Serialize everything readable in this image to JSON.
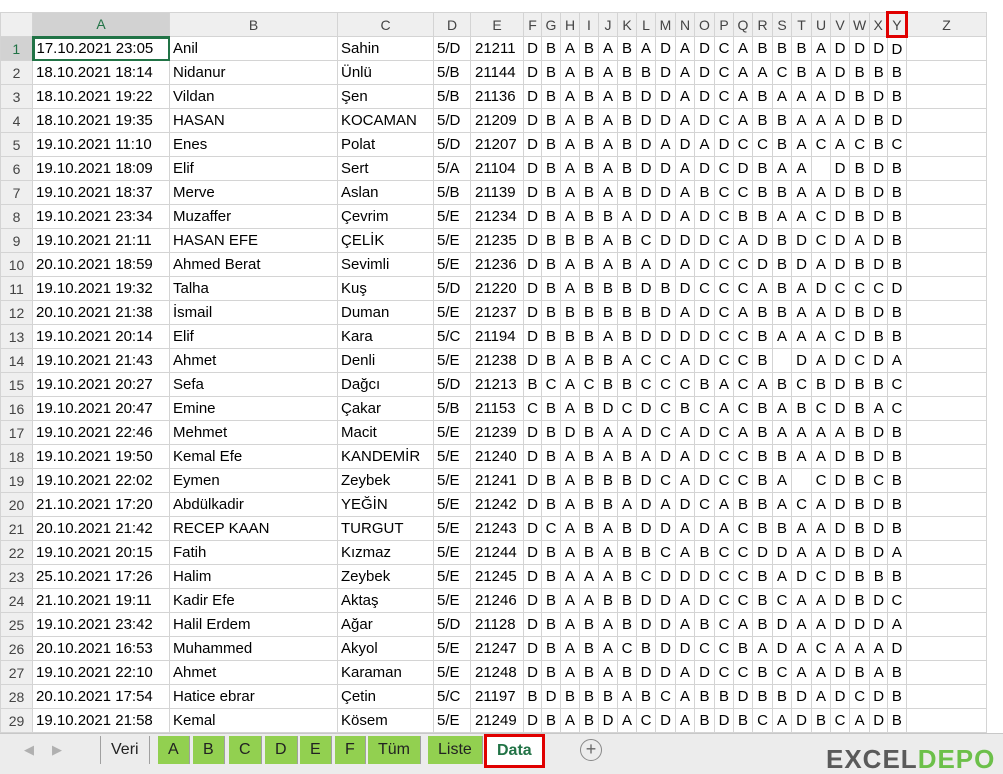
{
  "columns": [
    "A",
    "B",
    "C",
    "D",
    "E",
    "F",
    "G",
    "H",
    "I",
    "J",
    "K",
    "L",
    "M",
    "N",
    "O",
    "P",
    "Q",
    "R",
    "S",
    "T",
    "U",
    "V",
    "W",
    "X",
    "Y",
    "Z"
  ],
  "selected_column": "Y",
  "rows": [
    {
      "n": "1",
      "a": "17.10.2021 23:05",
      "b": "Anil",
      "c": "Sahin",
      "d": "5/D",
      "e": "21211",
      "ans": "DBABABADADCABBBADDDD"
    },
    {
      "n": "2",
      "a": "18.10.2021 18:14",
      "b": "Nidanur",
      "c": "Ünlü",
      "d": "5/B",
      "e": "21144",
      "ans": "DBABABBDADCAACBADBBB"
    },
    {
      "n": "3",
      "a": "18.10.2021 19:22",
      "b": "Vildan",
      "c": "Şen",
      "d": "5/B",
      "e": "21136",
      "ans": "DBABABDDADCABAAADBDB"
    },
    {
      "n": "4",
      "a": "18.10.2021 19:35",
      "b": "HASAN",
      "c": "KOCAMAN",
      "d": "5/D",
      "e": "21209",
      "ans": "DBABABDDADCABBAAADBDB"
    },
    {
      "n": "5",
      "a": "19.10.2021 11:10",
      "b": "Enes",
      "c": "Polat",
      "d": "5/D",
      "e": "21207",
      "ans": "DBABABDADADCCBACACBCB"
    },
    {
      "n": "6",
      "a": "19.10.2021 18:09",
      "b": "Elif",
      "c": "Sert",
      "d": "5/A",
      "e": "21104",
      "ans": "DBABABDDADCDBAA DBDB"
    },
    {
      "n": "7",
      "a": "19.10.2021 18:37",
      "b": "Merve",
      "c": "Aslan",
      "d": "5/B",
      "e": "21139",
      "ans": "DBABABDDABCCBBAADBDB"
    },
    {
      "n": "8",
      "a": "19.10.2021 23:34",
      "b": "Muzaffer",
      "c": "Çevrim",
      "d": "5/E",
      "e": "21234",
      "ans": "DBABBADDADCBBAACDBDB"
    },
    {
      "n": "9",
      "a": "19.10.2021 21:11",
      "b": "HASAN EFE",
      "c": "ÇELİK",
      "d": "5/E",
      "e": "21235",
      "ans": "DBBBABCDDDCADBDCDADB"
    },
    {
      "n": "10",
      "a": "20.10.2021 18:59",
      "b": "Ahmed Berat",
      "c": "Sevimli",
      "d": "5/E",
      "e": "21236",
      "ans": "DBABABADADCCDBDADBDB"
    },
    {
      "n": "11",
      "a": "19.10.2021 19:32",
      "b": "Talha",
      "c": "Kuş",
      "d": "5/D",
      "e": "21220",
      "ans": "DBABBBDBDCCCABADCCCD"
    },
    {
      "n": "12",
      "a": "20.10.2021 21:38",
      "b": "İsmail",
      "c": "Duman",
      "d": "5/E",
      "e": "21237",
      "ans": "DBBBBBBDADCABBAADBDB"
    },
    {
      "n": "13",
      "a": "19.10.2021 20:14",
      "b": "Elif",
      "c": "Kara",
      "d": "5/C",
      "e": "21194",
      "ans": "DBBBABDDDDCCBAAACDBB"
    },
    {
      "n": "14",
      "a": "19.10.2021 21:43",
      "b": "Ahmet",
      "c": "Denli",
      "d": "5/E",
      "e": "21238",
      "ans": "DBABBACCADCCB DADCDA"
    },
    {
      "n": "15",
      "a": "19.10.2021 20:27",
      "b": "Sefa",
      "c": "Dağcı",
      "d": "5/D",
      "e": "21213",
      "ans": "BCACBBCCCBACABCBDBBC"
    },
    {
      "n": "16",
      "a": "19.10.2021 20:47",
      "b": "Emine",
      "c": "Çakar",
      "d": "5/B",
      "e": "21153",
      "ans": "CBABDCDCBCACBABCDBAC"
    },
    {
      "n": "17",
      "a": "19.10.2021 22:46",
      "b": "Mehmet",
      "c": "Macit",
      "d": "5/E",
      "e": "21239",
      "ans": "DBDBAADCADCABAAAABDB"
    },
    {
      "n": "18",
      "a": "19.10.2021 19:50",
      "b": "Kemal Efe",
      "c": "KANDEMİR",
      "d": "5/E",
      "e": "21240",
      "ans": "DBABABADADCCBBAADBDB"
    },
    {
      "n": "19",
      "a": "19.10.2021 22:02",
      "b": "Eymen",
      "c": "Zeybek",
      "d": "5/E",
      "e": "21241",
      "ans": "DBABBBDCADCCBA CDBCB"
    },
    {
      "n": "20",
      "a": "21.10.2021 17:20",
      "b": "Abdülkadir",
      "c": "YEĞİN",
      "d": "5/E",
      "e": "21242",
      "ans": "DBABBADADCABBACADBDB"
    },
    {
      "n": "21",
      "a": "20.10.2021 21:42",
      "b": "RECEP KAAN",
      "c": "TURGUT",
      "d": "5/E",
      "e": "21243",
      "ans": "DCABABDDADACBBAADBDB"
    },
    {
      "n": "22",
      "a": "19.10.2021 20:15",
      "b": "Fatih",
      "c": "Kızmaz",
      "d": "5/E",
      "e": "21244",
      "ans": "DBABABBCABCCDDAADBDA"
    },
    {
      "n": "23",
      "a": "25.10.2021 17:26",
      "b": "Halim",
      "c": "Zeybek",
      "d": "5/E",
      "e": "21245",
      "ans": "DBAAABCDDDCCBADCDBBB"
    },
    {
      "n": "24",
      "a": "21.10.2021 19:11",
      "b": "Kadir Efe",
      "c": "Aktaş",
      "d": "5/E",
      "e": "21246",
      "ans": "DBAABBDDADCCBCAADBDC"
    },
    {
      "n": "25",
      "a": "19.10.2021 23:42",
      "b": "Halil Erdem",
      "c": "Ağar",
      "d": "5/D",
      "e": "21128",
      "ans": "DBABABDDABCABDAADDDA"
    },
    {
      "n": "26",
      "a": "20.10.2021 16:53",
      "b": "Muhammed",
      "c": "Akyol",
      "d": "5/E",
      "e": "21247",
      "ans": "DBABACBDDCCBADACAAAD"
    },
    {
      "n": "27",
      "a": "19.10.2021 22:10",
      "b": "Ahmet",
      "c": "Karaman",
      "d": "5/E",
      "e": "21248",
      "ans": "DBABABDDADCCBCAADBAB"
    },
    {
      "n": "28",
      "a": "20.10.2021 17:54",
      "b": "Hatice ebrar",
      "c": "Çetin",
      "d": "5/C",
      "e": "21197",
      "ans": "BDBBBABCABBDBBDADCDB"
    },
    {
      "n": "29",
      "a": "19.10.2021 21:58",
      "b": "Kemal",
      "c": "Kösem",
      "d": "5/E",
      "e": "21249",
      "ans": "DBABDACDABDBCADBCADB"
    }
  ],
  "tabs": {
    "veri": "Veri",
    "a": "A",
    "b": "B",
    "c": "C",
    "d": "D",
    "e": "E",
    "f": "F",
    "tum": "Tüm",
    "liste": "Liste",
    "data": "Data"
  },
  "add_sheet": "+",
  "logo": {
    "part1": "EXCEL",
    "part2": "DEPO"
  }
}
